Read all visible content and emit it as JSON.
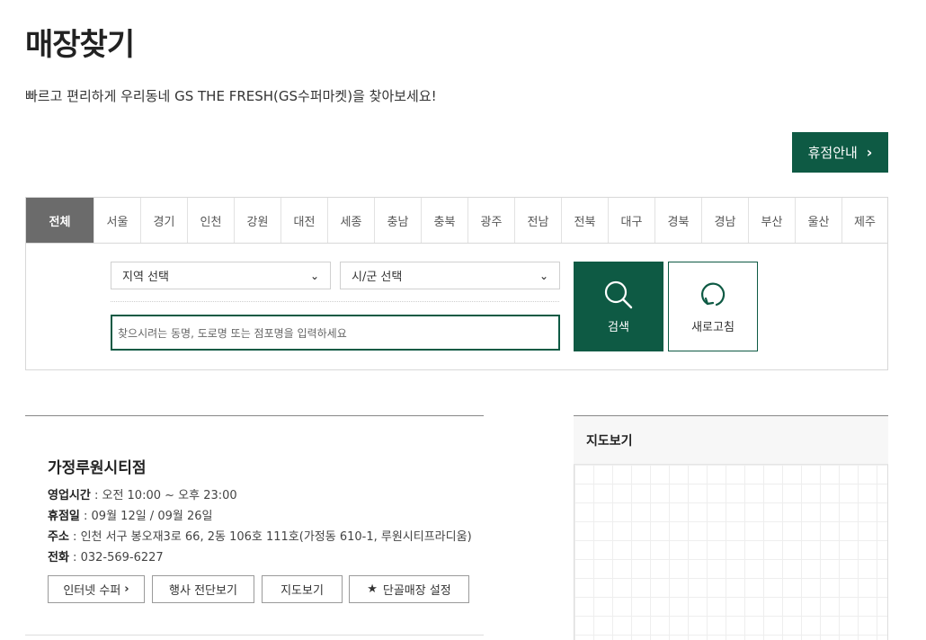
{
  "page": {
    "title": "매장찾기",
    "subtitle": "빠르고 편리하게 우리동네 GS THE FRESH(GS수퍼마켓)을 찾아보세요!",
    "closure_button": "휴점안내"
  },
  "regions": [
    "전체",
    "서울",
    "경기",
    "인천",
    "강원",
    "대전",
    "세종",
    "충남",
    "충북",
    "광주",
    "전남",
    "전북",
    "대구",
    "경북",
    "경남",
    "부산",
    "울산",
    "제주"
  ],
  "active_region": "전체",
  "search": {
    "region_select": "지역 선택",
    "city_select": "시/군 선택",
    "placeholder": "찾으시려는 동명, 도로명 또는 점포명을 입력하세요",
    "search_label": "검색",
    "refresh_label": "새로고침"
  },
  "store": {
    "name": "가정루원시티점",
    "hours_label": "영업시간",
    "hours": " : 오전 10:00 ~ 오후 23:00",
    "closed_label": "휴점일",
    "closed": " : 09월 12일 / 09월 26일",
    "address_label": "주소",
    "address": " : 인천 서구 봉오재3로 66, 2동 106호 111호(가정동 610-1, 루원시티프라디움)",
    "phone_label": "전화",
    "phone": " : 032-569-6227",
    "buttons": {
      "internet": "인터넷 수퍼",
      "flyer": "행사 전단보기",
      "map": "지도보기",
      "favorite": "단골매장 설정"
    }
  },
  "map": {
    "title": "지도보기"
  },
  "icons": {
    "search": "search-icon",
    "refresh": "refresh-icon",
    "chevron": "chevron-right-icon",
    "star": "star-icon",
    "caret": "caret-down-icon"
  },
  "colors": {
    "brand_green": "#0e5a44",
    "active_tab": "#6b6b6b"
  }
}
